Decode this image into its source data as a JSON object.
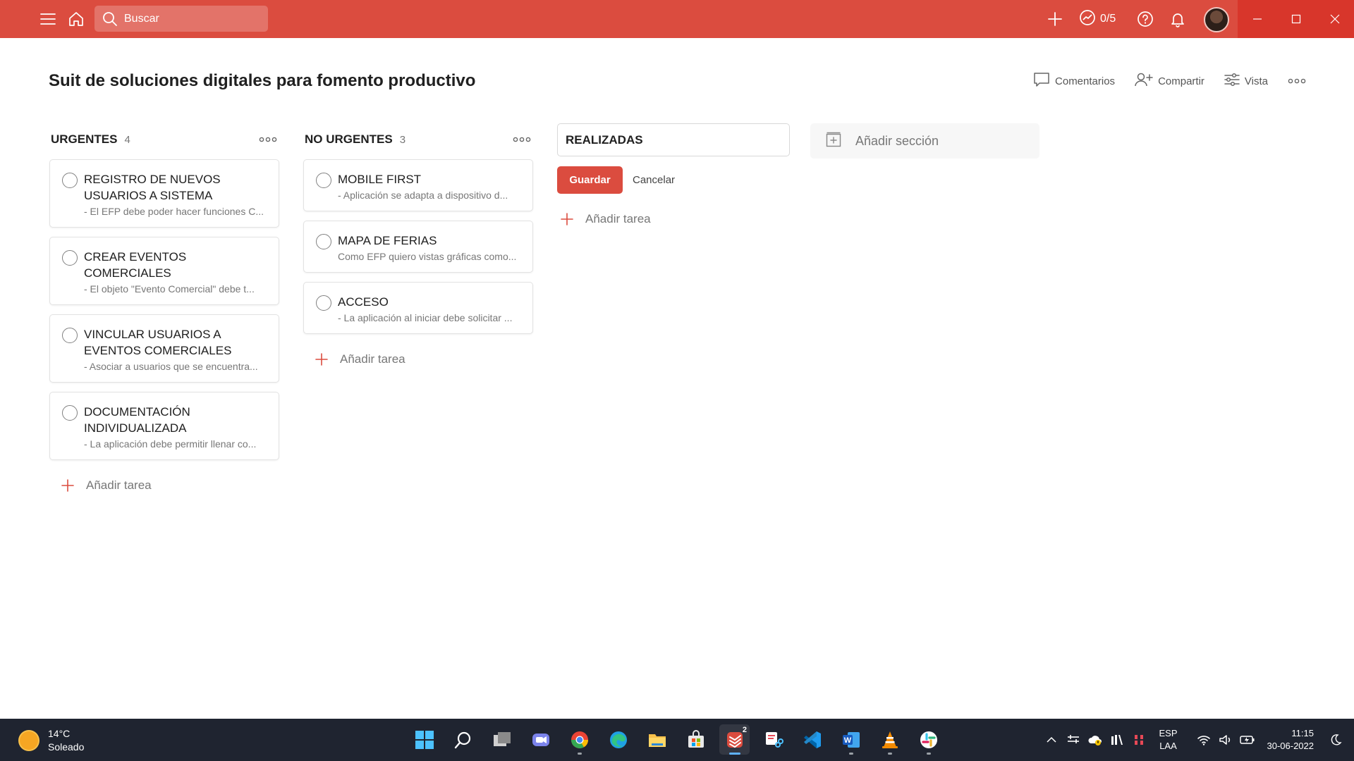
{
  "topbar": {
    "search_placeholder": "Buscar",
    "karma_text": "0/5",
    "icons": [
      "menu-icon",
      "home-icon",
      "search-icon",
      "plus-icon",
      "karma-icon",
      "help-icon",
      "bell-icon",
      "avatar"
    ],
    "accent": "#db4c3f"
  },
  "header": {
    "title": "Suit de soluciones digitales para fomento productivo",
    "comments_label": "Comentarios",
    "share_label": "Compartir",
    "view_label": "Vista"
  },
  "columns": [
    {
      "title": "URGENTES",
      "count": "4",
      "tasks": [
        {
          "title": "REGISTRO DE NUEVOS USUARIOS A SISTEMA",
          "desc": "- El EFP debe poder hacer funciones C..."
        },
        {
          "title": "CREAR EVENTOS COMERCIALES",
          "desc": "- El objeto \"Evento Comercial\" debe t..."
        },
        {
          "title": "VINCULAR USUARIOS A EVENTOS COMERCIALES",
          "desc": "- Asociar a usuarios que se encuentra..."
        },
        {
          "title": "DOCUMENTACIÓN INDIVIDUALIZADA",
          "desc": "- La aplicación debe permitir llenar co..."
        }
      ],
      "add_task_label": "Añadir tarea"
    },
    {
      "title": "NO URGENTES",
      "count": "3",
      "tasks": [
        {
          "title": "MOBILE FIRST",
          "desc": "- Aplicación se adapta a dispositivo d..."
        },
        {
          "title": "MAPA DE FERIAS",
          "desc": "Como EFP quiero vistas gráficas como..."
        },
        {
          "title": "ACCESO",
          "desc": "- La aplicación al iniciar debe solicitar ..."
        }
      ],
      "add_task_label": "Añadir tarea"
    }
  ],
  "section_edit": {
    "value": "REALIZADAS",
    "save_label": "Guardar",
    "cancel_label": "Cancelar",
    "add_task_label": "Añadir tarea"
  },
  "add_section_label": "Añadir sección",
  "taskbar": {
    "weather_temp": "14°C",
    "weather_desc": "Soleado",
    "apps": [
      "windows-start-icon",
      "search-icon",
      "task-view-icon",
      "chat-icon",
      "chrome-icon",
      "edge-icon",
      "file-explorer-icon",
      "store-icon",
      "todoist-icon",
      "snipping-tool-icon",
      "vscode-icon",
      "word-icon",
      "vlc-icon",
      "slack-icon"
    ],
    "todoist_badge": "2",
    "lang_1": "ESP",
    "lang_2": "LAA",
    "time": "11:15",
    "date": "30-06-2022"
  }
}
